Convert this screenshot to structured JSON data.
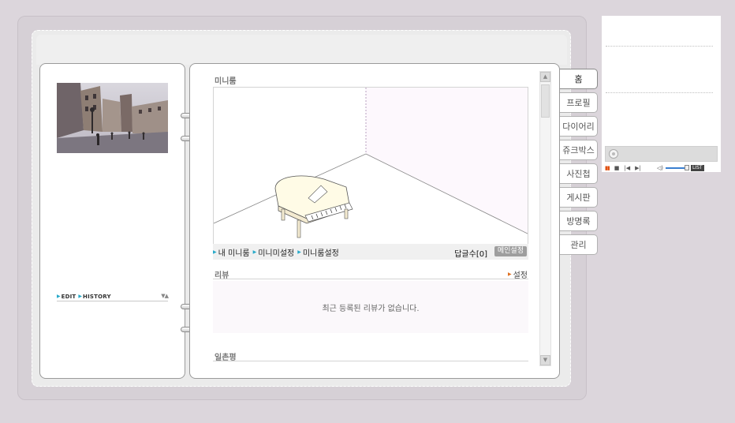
{
  "profile": {
    "edit_label": "EDIT",
    "history_label": "HISTORY"
  },
  "miniroom": {
    "title": "미니룸",
    "links": [
      "내 미니룸",
      "미니미설정",
      "미니룸설정"
    ],
    "reply_count": "답글수[0]",
    "main_setting": "메인설정"
  },
  "review": {
    "title": "리뷰",
    "setting_label": "설정",
    "empty_message": "최근 등록된 리뷰가 없습니다."
  },
  "ilchon": {
    "title": "일촌평"
  },
  "tabs": [
    {
      "label": "홈",
      "active": true
    },
    {
      "label": "프로필",
      "active": false
    },
    {
      "label": "다이어리",
      "active": false
    },
    {
      "label": "쥬크박스",
      "active": false
    },
    {
      "label": "사진첩",
      "active": false
    },
    {
      "label": "게시판",
      "active": false
    },
    {
      "label": "방명록",
      "active": false
    },
    {
      "label": "관리",
      "active": false
    }
  ],
  "player": {
    "list_label": "LIST"
  },
  "icons": {
    "scroll_up": "triangle-up-icon",
    "scroll_down": "triangle-down-icon",
    "link_marker": "triangle-right-icon",
    "disc": "disc-icon",
    "pause": "pause-icon",
    "stop": "stop-icon",
    "prev": "prev-icon",
    "next": "next-icon",
    "volume": "volume-icon"
  },
  "colors": {
    "background": "#dcd6dc",
    "link_marker": "#26a9c9",
    "setting_marker": "#e07020",
    "volume_track": "#3a7fd0"
  }
}
